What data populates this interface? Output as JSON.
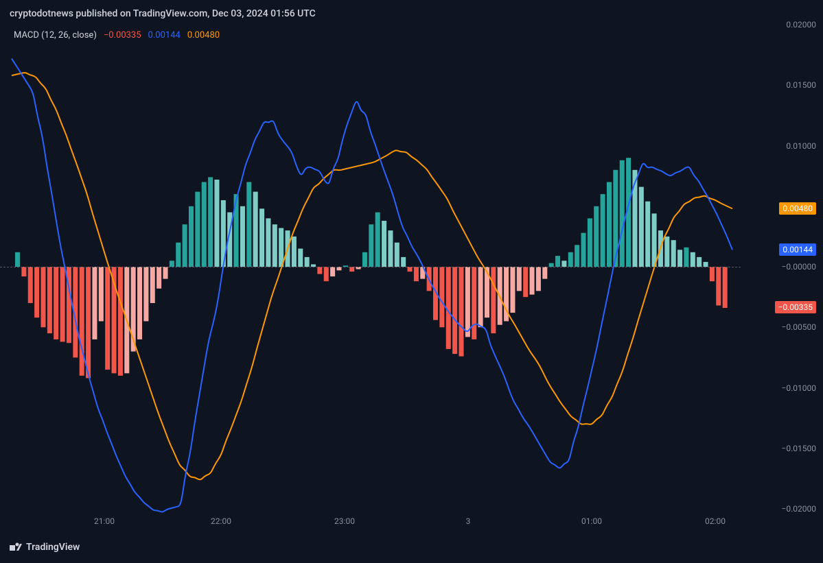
{
  "attribution": "cryptodotnews published on TradingView.com, Dec 03, 2024 01:56 UTC",
  "legend": {
    "indicator": "MACD (12, 26, close)",
    "hist_value": "−0.00335",
    "macd_value": "0.00144",
    "signal_value": "0.00480"
  },
  "brand": "TradingView",
  "yaxis": {
    "ticks": [
      "0.02000",
      "0.01500",
      "0.01000",
      "0.00500",
      "−0.00000",
      "−0.00500",
      "−0.01000",
      "−0.01500",
      "−0.02000"
    ],
    "badges": {
      "signal": "0.00480",
      "macd": "0.00144",
      "hist": "−0.00335"
    }
  },
  "xaxis": {
    "ticks": [
      "21:00",
      "22:00",
      "23:00",
      "3",
      "01:00",
      "02:00"
    ]
  },
  "chart_data": {
    "type": "bar+line",
    "indicator": "MACD",
    "params": [
      12,
      26,
      "close"
    ],
    "ylim": [
      -0.02,
      0.02
    ],
    "x_time_labels": [
      "21:00",
      "22:00",
      "23:00",
      "00:00 (3)",
      "01:00",
      "02:00"
    ],
    "histogram": [
      0.0012,
      -0.0008,
      -0.003,
      -0.0042,
      -0.005,
      -0.0055,
      -0.006,
      -0.0062,
      -0.0063,
      -0.0075,
      -0.009,
      -0.0092,
      -0.006,
      -0.0045,
      -0.0085,
      -0.0088,
      -0.009,
      -0.0088,
      -0.007,
      -0.006,
      -0.0045,
      -0.003,
      -0.0018,
      -0.001,
      0.0005,
      0.002,
      0.0035,
      0.005,
      0.0062,
      0.007,
      0.0074,
      0.0072,
      0.0055,
      0.0045,
      0.006,
      0.005,
      0.007,
      0.0062,
      0.0048,
      0.004,
      0.0035,
      0.0032,
      0.003,
      0.0025,
      0.0015,
      0.0008,
      0.0002,
      -0.0006,
      -0.0012,
      -0.0008,
      -0.0003,
      0.0001,
      -0.0004,
      -0.0002,
      0.0012,
      0.0035,
      0.0045,
      0.0038,
      0.003,
      0.002,
      0.0008,
      -0.0004,
      -0.0012,
      -0.001,
      -0.002,
      -0.0044,
      -0.005,
      -0.0068,
      -0.0072,
      -0.0074,
      -0.0058,
      -0.006,
      -0.005,
      -0.0042,
      -0.0055,
      -0.0048,
      -0.0045,
      -0.0038,
      -0.002,
      -0.0025,
      -0.0023,
      -0.002,
      -0.001,
      0.0003,
      0.0009,
      0.0005,
      0.0012,
      0.0018,
      0.0028,
      0.004,
      0.005,
      0.006,
      0.007,
      0.008,
      0.0088,
      0.009,
      0.008,
      0.0066,
      0.0054,
      0.0044,
      0.003,
      0.0025,
      0.0022,
      0.0014,
      0.0016,
      0.0012,
      0.0008,
      0.0004,
      -0.0012,
      -0.0032,
      -0.0034
    ],
    "macd_line": [
      0.0172,
      0.016,
      0.0148,
      0.0118,
      0.0075,
      0.003,
      -0.001,
      -0.0048,
      -0.008,
      -0.0108,
      -0.013,
      -0.015,
      -0.0168,
      -0.0182,
      -0.0192,
      -0.0199,
      -0.0202,
      -0.02,
      -0.0198,
      -0.0165,
      -0.012,
      -0.0075,
      -0.004,
      0.0005,
      0.0044,
      0.0075,
      0.0098,
      0.0115,
      0.012,
      0.0108,
      0.0098,
      0.008,
      0.0082,
      0.008,
      0.007,
      0.0084,
      0.011,
      0.0132,
      0.0128,
      0.0108,
      0.0086,
      0.0065,
      0.004,
      0.0022,
      0.0008,
      -0.0008,
      -0.0022,
      -0.0034,
      -0.0044,
      -0.0052,
      -0.0048,
      -0.005,
      -0.0068,
      -0.0085,
      -0.0105,
      -0.012,
      -0.0132,
      -0.0145,
      -0.0158,
      -0.0165,
      -0.0162,
      -0.014,
      -0.011,
      -0.0078,
      -0.0042,
      -0.0005,
      0.0028,
      0.0058,
      0.008,
      0.0082,
      0.008,
      0.0076,
      0.0078,
      0.0082,
      0.0074,
      0.0062,
      0.0048,
      0.0032,
      0.0014
    ],
    "signal_line": [
      0.0158,
      0.016,
      0.0158,
      0.015,
      0.0135,
      0.0115,
      0.0092,
      0.0068,
      0.004,
      0.0012,
      -0.0015,
      -0.004,
      -0.0065,
      -0.009,
      -0.0115,
      -0.0138,
      -0.0158,
      -0.017,
      -0.0175,
      -0.0172,
      -0.016,
      -0.014,
      -0.0118,
      -0.0092,
      -0.0062,
      -0.0032,
      -0.0006,
      0.002,
      0.0042,
      0.006,
      0.007,
      0.0078,
      0.008,
      0.0082,
      0.0084,
      0.0086,
      0.009,
      0.0095,
      0.0095,
      0.009,
      0.0083,
      0.0072,
      0.006,
      0.0044,
      0.0028,
      0.0012,
      -0.0002,
      -0.0018,
      -0.0035,
      -0.005,
      -0.0065,
      -0.0078,
      -0.0094,
      -0.0108,
      -0.012,
      -0.0128,
      -0.013,
      -0.0125,
      -0.0112,
      -0.0093,
      -0.0068,
      -0.004,
      -0.0012,
      0.0015,
      0.0035,
      0.0048,
      0.0055,
      0.0058,
      0.0056,
      0.0052,
      0.0048
    ],
    "current": {
      "histogram": -0.00335,
      "macd": 0.00144,
      "signal": 0.0048
    }
  }
}
